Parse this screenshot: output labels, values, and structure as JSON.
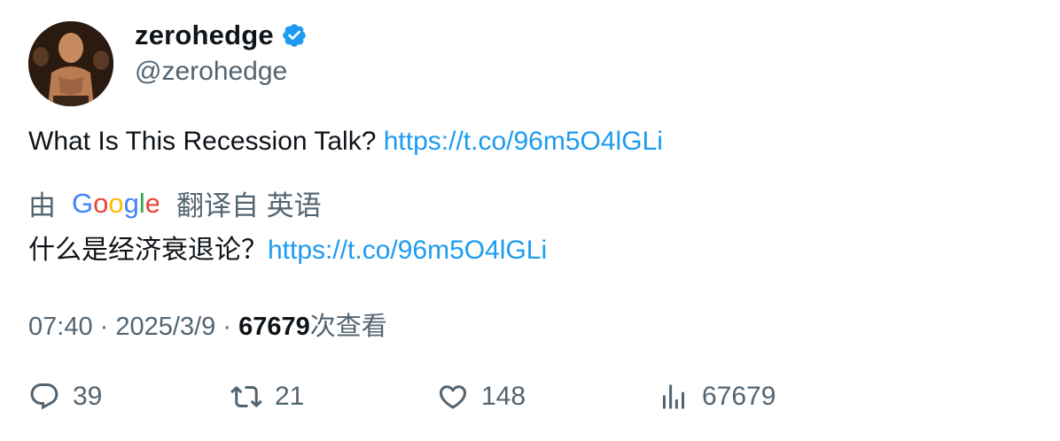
{
  "author": {
    "display_name": "zerohedge",
    "handle": "@zerohedge",
    "verified": true,
    "avatar_icon": "profile-photo"
  },
  "tweet": {
    "text": "What Is This Recession Talk?",
    "link": "https://t.co/96m5O4lGLi"
  },
  "translation": {
    "prefix": "由",
    "provider": "Google",
    "suffix": "翻译自 英语",
    "text": "什么是经济衰退论？",
    "link": "https://t.co/96m5O4lGLi"
  },
  "meta": {
    "time": "07:40",
    "separator": "·",
    "date": "2025/3/9",
    "views_count": "67679",
    "views_label": "次查看"
  },
  "actions": {
    "replies": "39",
    "retweets": "21",
    "likes": "148",
    "views": "67679"
  },
  "colors": {
    "link": "#1d9bf0",
    "secondary_text": "#536471",
    "primary_text": "#0f1419",
    "verified": "#1d9bf0"
  }
}
